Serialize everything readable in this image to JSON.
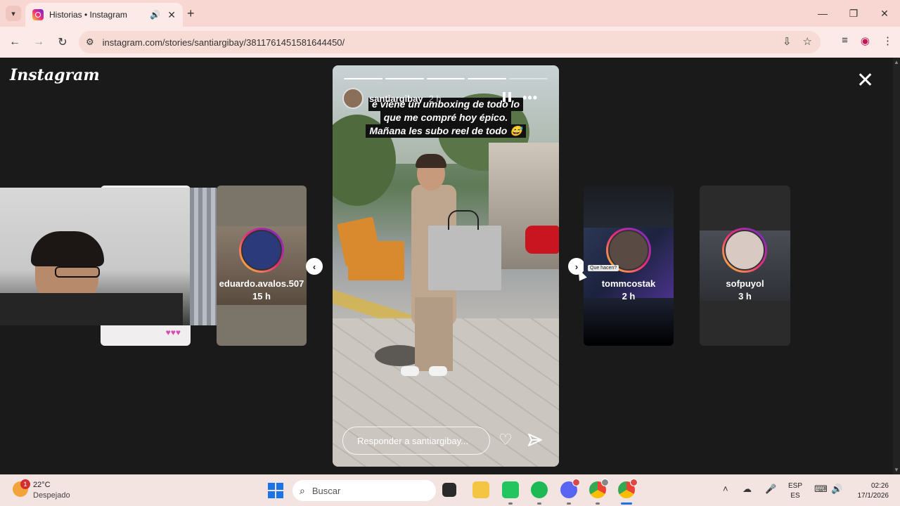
{
  "browser": {
    "tab_title": "Historias • Instagram",
    "url": "instagram.com/stories/santiargibay/3811761451581644450/"
  },
  "instagram": {
    "logo": "Instagram",
    "story": {
      "username": "santiargibay",
      "time": "2 h",
      "caption": [
        "e viene un umboxing de todo lo",
        "que me compré hoy épico.",
        "Mañana les subo reel de todo 😅"
      ],
      "reply_placeholder": "Responder a santiargibay...",
      "progress_segments_total": 5,
      "progress_segments_done": 4
    },
    "side_stories": [
      {
        "username": "eduardo.avalos.507",
        "time": "15 h"
      },
      {
        "username": "tommcostak",
        "time": "2 h"
      },
      {
        "username": "sofpuyol",
        "time": "3 h"
      }
    ],
    "tooltip": "Que hacen?"
  },
  "taskbar": {
    "weather_temp": "22°C",
    "weather_condition": "Despejado",
    "weather_badge": "1",
    "search_placeholder": "Buscar",
    "lang_line1": "ESP",
    "lang_line2": "ES",
    "time": "02:26",
    "date": "17/1/2026"
  },
  "colors": {
    "story_ring": "#ee2a7b",
    "page_bg": "#1a1a1a",
    "tab_bar": "#f8d7d2"
  }
}
